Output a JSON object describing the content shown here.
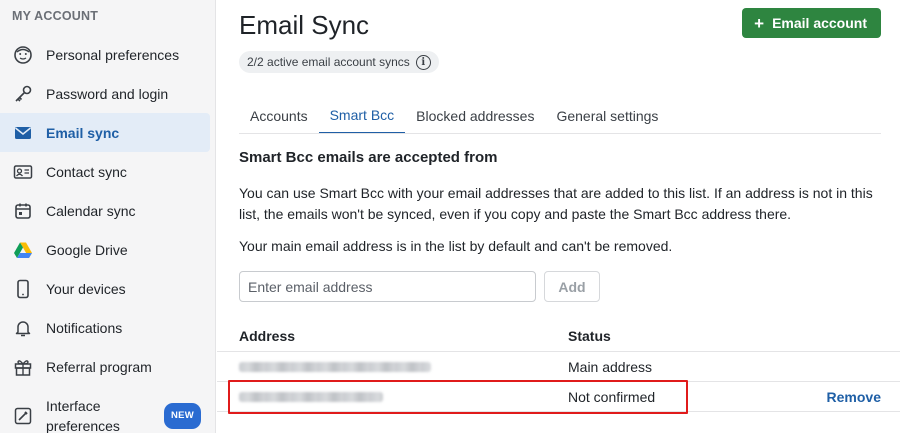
{
  "sidebar": {
    "heading": "MY ACCOUNT",
    "items": [
      {
        "label": "Personal preferences",
        "icon": "face-icon"
      },
      {
        "label": "Password and login",
        "icon": "key-icon"
      },
      {
        "label": "Email sync",
        "icon": "envelope-icon",
        "active": true
      },
      {
        "label": "Contact sync",
        "icon": "contact-card-icon"
      },
      {
        "label": "Calendar sync",
        "icon": "calendar-icon"
      },
      {
        "label": "Google Drive",
        "icon": "google-drive-icon"
      },
      {
        "label": "Your devices",
        "icon": "phone-icon"
      },
      {
        "label": "Notifications",
        "icon": "bell-icon"
      },
      {
        "label": "Referral program",
        "icon": "gift-icon"
      },
      {
        "label": "Interface preferences",
        "icon": "interface-icon",
        "badge": "NEW"
      }
    ]
  },
  "header": {
    "title": "Email Sync",
    "add_button_label": "Email account",
    "sync_status": "2/2 active email account syncs"
  },
  "tabs": [
    {
      "label": "Accounts"
    },
    {
      "label": "Smart Bcc",
      "active": true
    },
    {
      "label": "Blocked addresses"
    },
    {
      "label": "General settings"
    }
  ],
  "content": {
    "section_title": "Smart Bcc emails are accepted from",
    "description": "You can use Smart Bcc with your email addresses that are added to this list. If an address is not in this list, the emails won't be synced, even if you copy and paste the Smart Bcc address there.",
    "default_note": "Your main email address is in the list by default and can't be removed.",
    "input_placeholder": "Enter email address",
    "add_label": "Add"
  },
  "table": {
    "headers": {
      "address": "Address",
      "status": "Status"
    },
    "rows": [
      {
        "status": "Main address",
        "action": ""
      },
      {
        "status": "Not confirmed",
        "action": "Remove"
      }
    ]
  },
  "colors": {
    "primary_green": "#2e8540",
    "accent_blue": "#1f5fa6",
    "highlight_red": "#e01b1b",
    "badge_blue": "#2a6bd1"
  }
}
